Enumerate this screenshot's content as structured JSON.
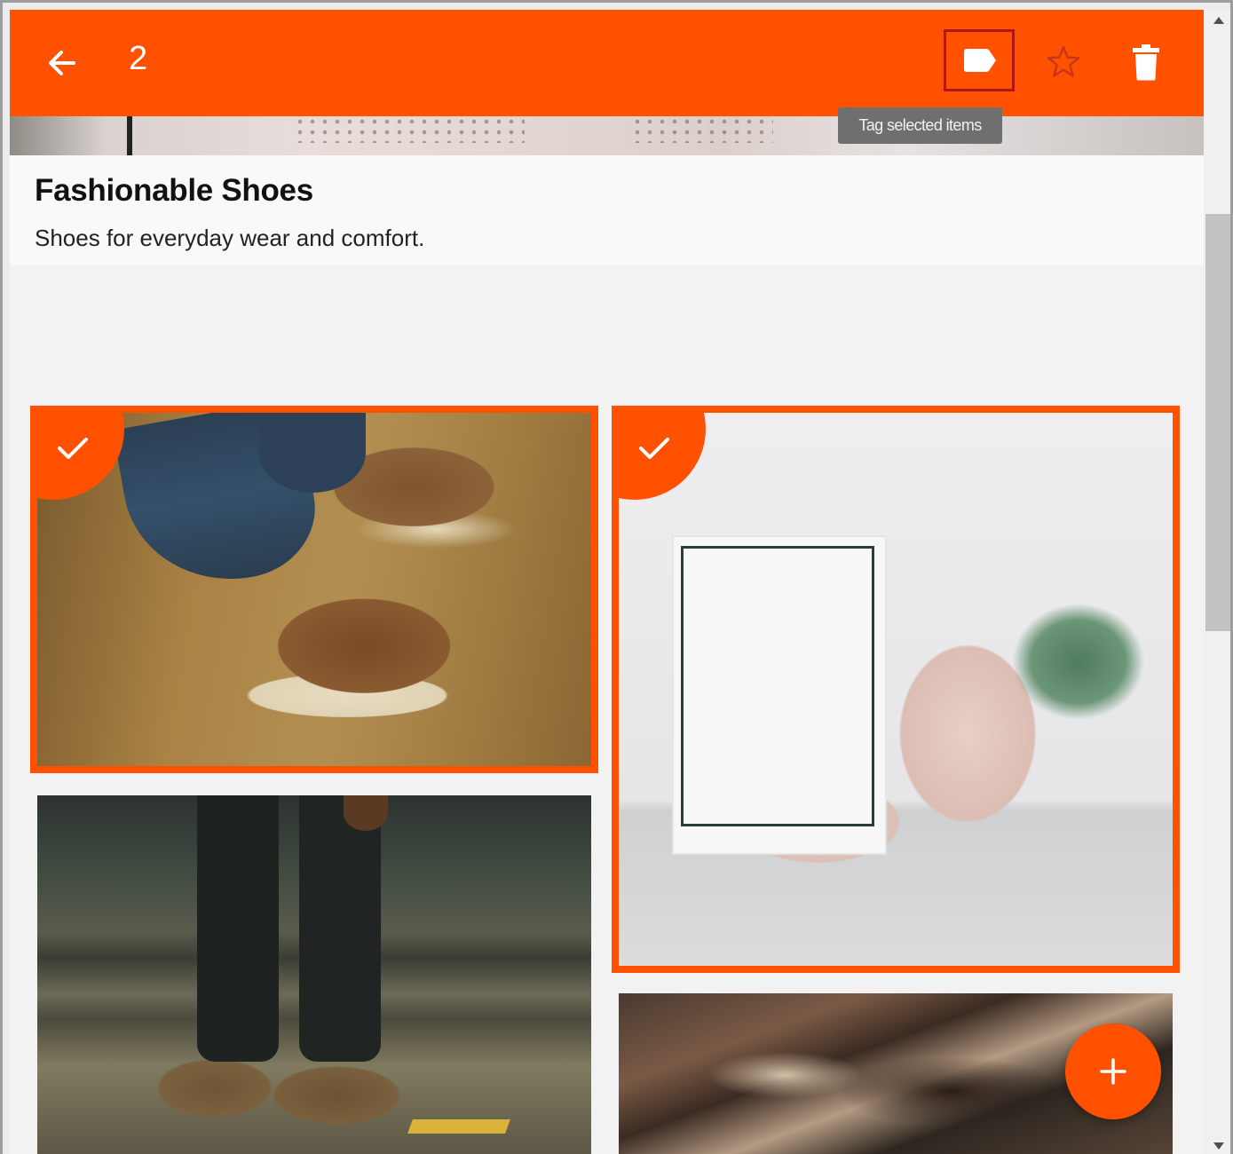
{
  "app_bar": {
    "back_icon": "arrow-left-icon",
    "selected_count": "2",
    "actions": [
      {
        "name": "tag",
        "icon": "label-icon"
      },
      {
        "name": "favorite",
        "icon": "star-outline-icon"
      },
      {
        "name": "delete",
        "icon": "trash-icon"
      }
    ],
    "tooltip": "Tag selected items"
  },
  "album": {
    "title": "Fashionable Shoes",
    "description": "Shoes for everyday wear and comfort."
  },
  "photos": [
    {
      "subject": "boat shoes on wooden floor",
      "selected": true
    },
    {
      "subject": "pink brogues with plant",
      "selected": true
    },
    {
      "subject": "boots on stairs",
      "selected": false
    },
    {
      "subject": "shoe rack",
      "selected": false
    }
  ],
  "fab": {
    "icon": "plus-icon"
  },
  "colors": {
    "accent": "#ff5100",
    "tag_button_outline": "#b0151a",
    "tooltip_bg": "#6f6f6f",
    "background": "#f2f2f2"
  }
}
